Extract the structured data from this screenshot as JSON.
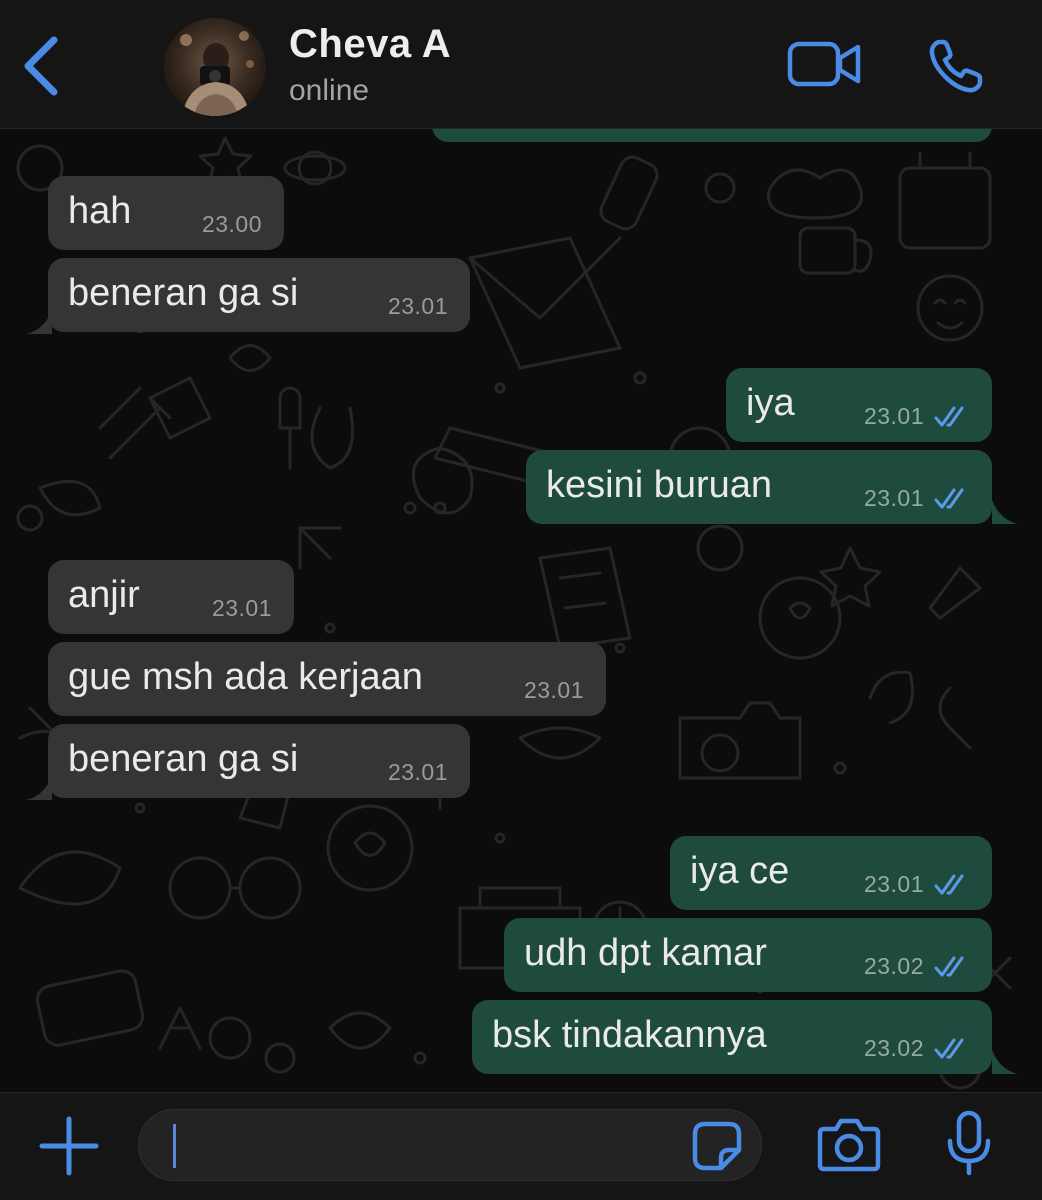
{
  "header": {
    "back_icon": "chevron-left-icon",
    "contact_name": "Cheva A",
    "status": "online",
    "video_icon": "video-camera-icon",
    "call_icon": "phone-icon"
  },
  "colors": {
    "accent": "#4a8be6",
    "incoming_bubble": "#353535",
    "outgoing_bubble": "#1f4b3f",
    "read_ticks": "#5b9ae8"
  },
  "messages": [
    {
      "direction": "in",
      "text": "hah",
      "time": "23.00"
    },
    {
      "direction": "in",
      "text": "beneran ga si",
      "time": "23.01"
    },
    {
      "direction": "out",
      "text": "iya",
      "time": "23.01",
      "read": true
    },
    {
      "direction": "out",
      "text": "kesini buruan",
      "time": "23.01",
      "read": true
    },
    {
      "direction": "in",
      "text": "anjir",
      "time": "23.01"
    },
    {
      "direction": "in",
      "text": "gue msh ada kerjaan",
      "time": "23.01"
    },
    {
      "direction": "in",
      "text": "beneran ga si",
      "time": "23.01"
    },
    {
      "direction": "out",
      "text": "iya ce",
      "time": "23.01",
      "read": true
    },
    {
      "direction": "out",
      "text": "udh dpt kamar",
      "time": "23.02",
      "read": true
    },
    {
      "direction": "out",
      "text": "bsk tindakannya",
      "time": "23.02",
      "read": true
    }
  ],
  "composer": {
    "plus_icon": "plus-icon",
    "input_value": "",
    "sticker_icon": "sticker-icon",
    "camera_icon": "camera-icon",
    "mic_icon": "microphone-icon"
  }
}
